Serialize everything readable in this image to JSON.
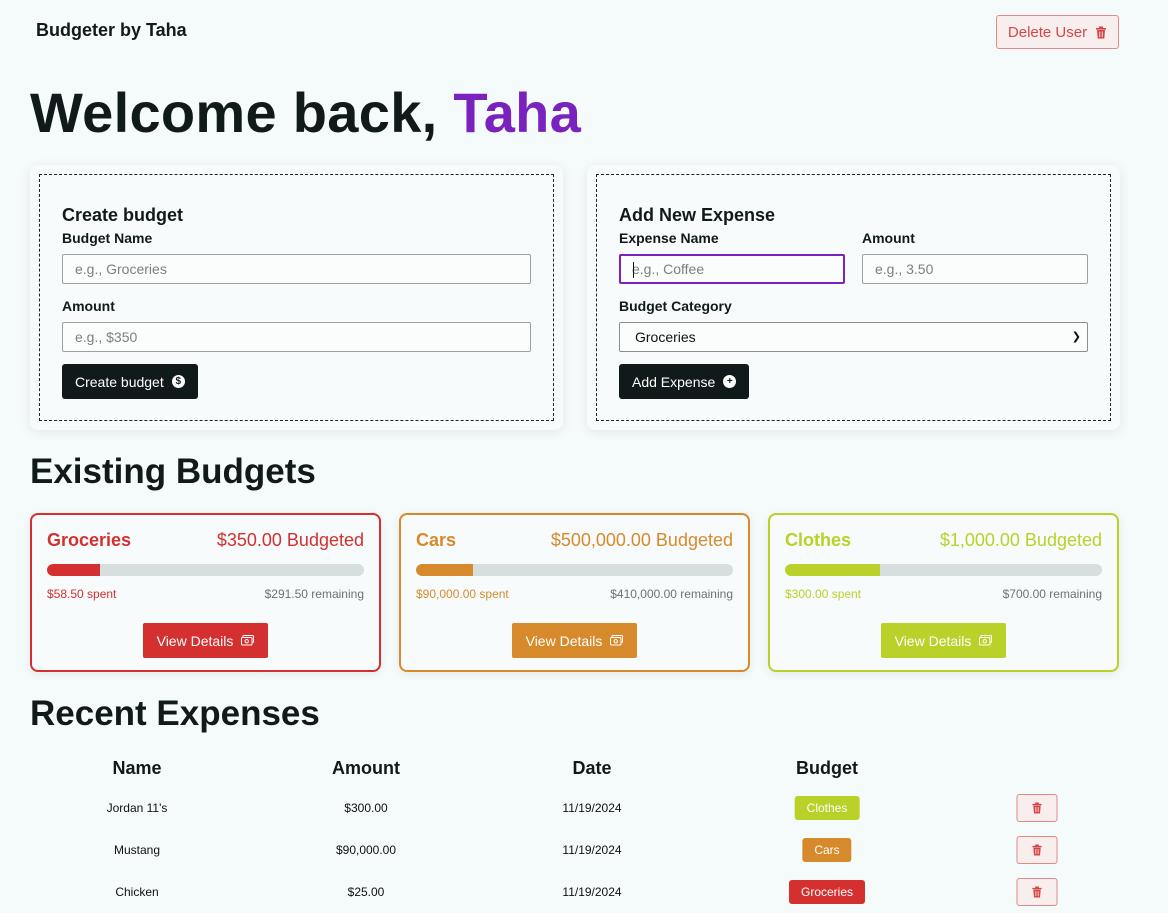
{
  "nav": {
    "brand": "Budgeter by Taha",
    "delete_user_label": "Delete User"
  },
  "welcome": {
    "prefix": "Welcome back,",
    "name": "Taha"
  },
  "create_budget": {
    "title": "Create budget",
    "name_label": "Budget Name",
    "name_placeholder": "e.g., Groceries",
    "amount_label": "Amount",
    "amount_placeholder": "e.g., $350",
    "button_label": "Create budget"
  },
  "add_expense": {
    "title": "Add New Expense",
    "name_label": "Expense Name",
    "name_placeholder": "e.g., Coffee",
    "amount_label": "Amount",
    "amount_placeholder": "e.g., 3.50",
    "category_label": "Budget Category",
    "category_selected": "Groceries",
    "button_label": "Add Expense"
  },
  "existing_budgets": {
    "title": "Existing Budgets",
    "view_label": "View Details",
    "items": [
      {
        "name": "Groceries",
        "budgeted": "$350.00 Budgeted",
        "spent": "$58.50 spent",
        "remaining": "$291.50 remaining",
        "progress": 0.167,
        "color": "#d3302f"
      },
      {
        "name": "Cars",
        "budgeted": "$500,000.00 Budgeted",
        "spent": "$90,000.00 spent",
        "remaining": "$410,000.00 remaining",
        "progress": 0.18,
        "color": "#d78a2c"
      },
      {
        "name": "Clothes",
        "budgeted": "$1,000.00 Budgeted",
        "spent": "$300.00 spent",
        "remaining": "$700.00 remaining",
        "progress": 0.3,
        "color": "#b9d128"
      }
    ]
  },
  "recent_expenses": {
    "title": "Recent Expenses",
    "headers": [
      "Name",
      "Amount",
      "Date",
      "Budget"
    ],
    "rows": [
      {
        "name": "Jordan 11's",
        "amount": "$300.00",
        "date": "11/19/2024",
        "budget": "Clothes",
        "color": "#b9d128"
      },
      {
        "name": "Mustang",
        "amount": "$90,000.00",
        "date": "11/19/2024",
        "budget": "Cars",
        "color": "#d78a2c"
      },
      {
        "name": "Chicken",
        "amount": "$25.00",
        "date": "11/19/2024",
        "budget": "Groceries",
        "color": "#d3302f"
      }
    ]
  }
}
